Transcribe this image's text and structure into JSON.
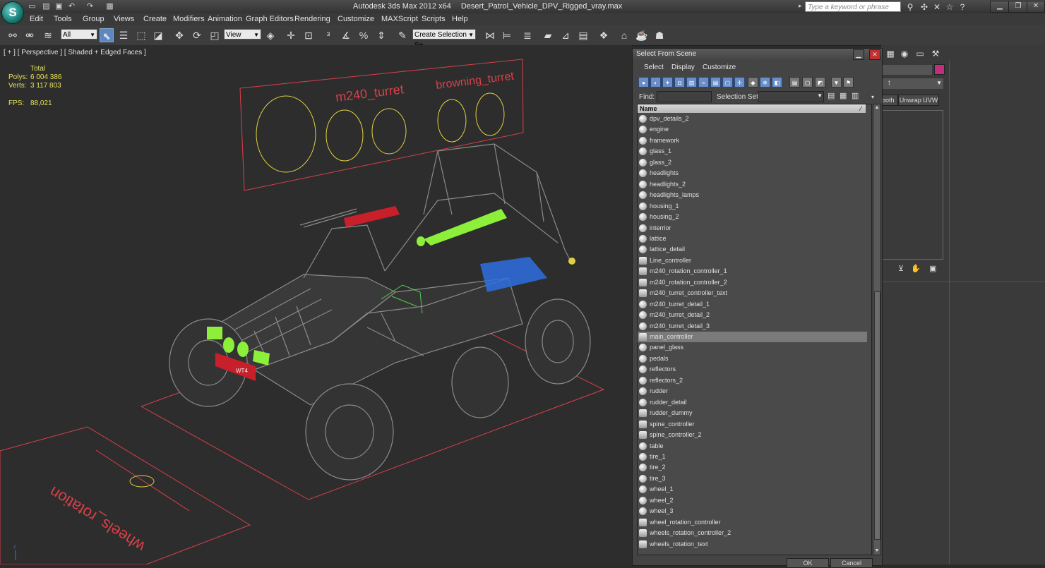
{
  "app": {
    "logo_glyph": "S",
    "title": "Autodesk 3ds Max  2012 x64",
    "file": "Desert_Patrol_Vehicle_DPV_Rigged_vray.max",
    "search_placeholder": "Type a keyword or phrase"
  },
  "menu": [
    "Edit",
    "Tools",
    "Group",
    "Views",
    "Create",
    "Modifiers",
    "Animation",
    "Graph Editors",
    "Rendering",
    "Customize",
    "MAXScript",
    "Scripts",
    "Help"
  ],
  "toolbar": {
    "filter_value": "All",
    "ref_coord_value": "View",
    "selection_set_value": "Create Selection Se"
  },
  "viewport": {
    "label": "[ + ] [ Perspective ] [ Shaded + Edged Faces ]",
    "stats": {
      "header": "Total",
      "polys_label": "Polys:",
      "polys_value": "6 004 386",
      "verts_label": "Verts:",
      "verts_value": "3 117 803",
      "fps_label": "FPS:",
      "fps_value": "88,021"
    },
    "scene_labels": {
      "m240": "m240_turret",
      "browning": "browning_turret",
      "wheels": "wheels_rotation",
      "plate": "WT4"
    }
  },
  "dialog": {
    "title": "Select From Scene",
    "menu": [
      "Select",
      "Display",
      "Customize"
    ],
    "find_label": "Find:",
    "selection_set_label": "Selection Set:",
    "column_name": "Name",
    "selected_item": "main_controller",
    "items": [
      {
        "name": "dpv_details_2",
        "kind": "geo"
      },
      {
        "name": "engine",
        "kind": "geo"
      },
      {
        "name": "framework",
        "kind": "geo"
      },
      {
        "name": "glass_1",
        "kind": "geo"
      },
      {
        "name": "glass_2",
        "kind": "geo"
      },
      {
        "name": "headlights",
        "kind": "geo"
      },
      {
        "name": "headlights_2",
        "kind": "geo"
      },
      {
        "name": "headlights_lamps",
        "kind": "geo"
      },
      {
        "name": "housing_1",
        "kind": "geo"
      },
      {
        "name": "housing_2",
        "kind": "geo"
      },
      {
        "name": "interrior",
        "kind": "geo"
      },
      {
        "name": "lattice",
        "kind": "geo"
      },
      {
        "name": "lattice_detail",
        "kind": "geo"
      },
      {
        "name": "Line_controller",
        "kind": "helper"
      },
      {
        "name": "m240_rotation_controller_1",
        "kind": "helper"
      },
      {
        "name": "m240_rotation_controller_2",
        "kind": "helper"
      },
      {
        "name": "m240_turret_controller_text",
        "kind": "helper"
      },
      {
        "name": "m240_turret_detail_1",
        "kind": "geo"
      },
      {
        "name": "m240_turret_detail_2",
        "kind": "geo"
      },
      {
        "name": "m240_turret_detail_3",
        "kind": "geo"
      },
      {
        "name": "main_controller",
        "kind": "helper"
      },
      {
        "name": "panel_glass",
        "kind": "geo"
      },
      {
        "name": "pedals",
        "kind": "geo"
      },
      {
        "name": "reflectors",
        "kind": "geo"
      },
      {
        "name": "reflectors_2",
        "kind": "geo"
      },
      {
        "name": "rudder",
        "kind": "geo"
      },
      {
        "name": "rudder_detail",
        "kind": "geo"
      },
      {
        "name": "rudder_dummy",
        "kind": "helper"
      },
      {
        "name": "spine_controller",
        "kind": "helper"
      },
      {
        "name": "spine_controller_2",
        "kind": "helper"
      },
      {
        "name": "table",
        "kind": "geo"
      },
      {
        "name": "tire_1",
        "kind": "geo"
      },
      {
        "name": "tire_2",
        "kind": "geo"
      },
      {
        "name": "tire_3",
        "kind": "geo"
      },
      {
        "name": "wheel_1",
        "kind": "geo"
      },
      {
        "name": "wheel_2",
        "kind": "geo"
      },
      {
        "name": "wheel_3",
        "kind": "geo"
      },
      {
        "name": "wheel_rotation_controller",
        "kind": "helper"
      },
      {
        "name": "wheels_rotation_controller_2",
        "kind": "helper"
      },
      {
        "name": "wheels_rotation_text",
        "kind": "helper"
      }
    ],
    "ok_label": "OK",
    "cancel_label": "Cancel"
  },
  "command_panel": {
    "smooth_label": "ooth",
    "unwrap_label": "Unwrap UVW",
    "swatch_color": "#c0307a"
  },
  "colors": {
    "wire": "#8a8a8a",
    "controller_red": "#d8404a",
    "controller_yellow": "#e0d040",
    "highlight_green": "#8cf03a",
    "highlight_blue": "#2f6fe0"
  }
}
